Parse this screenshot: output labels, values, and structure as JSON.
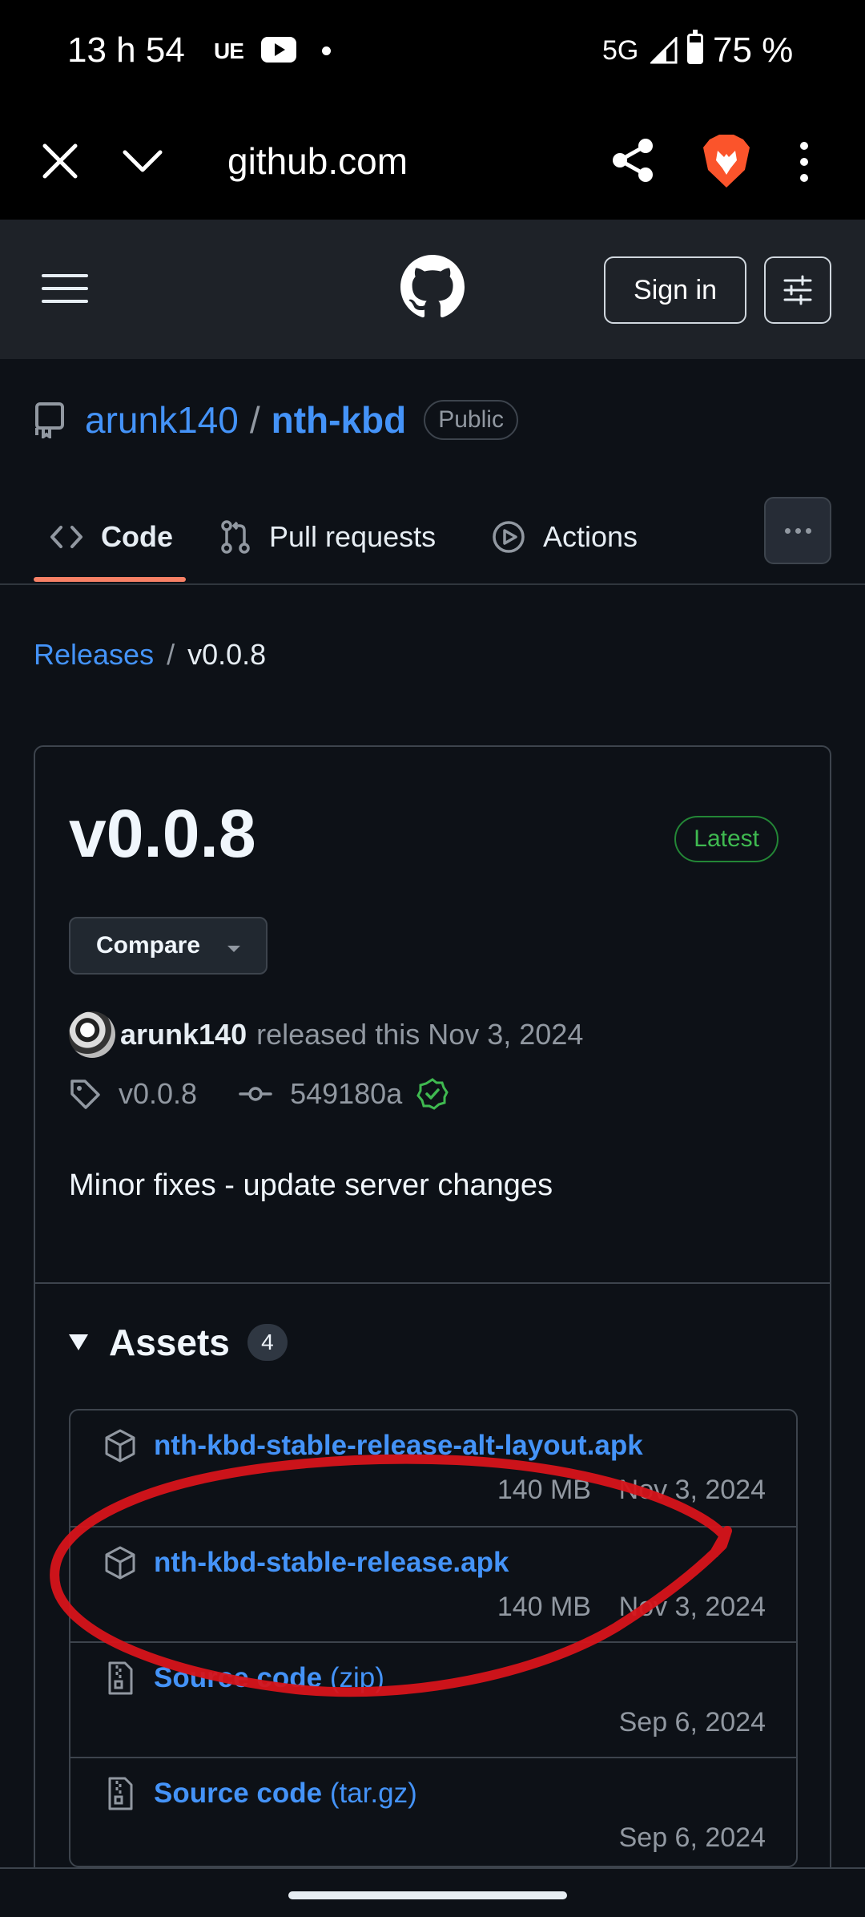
{
  "status": {
    "time": "13 h 54",
    "carrier": "UE",
    "network": "5G",
    "battery": "75 %"
  },
  "browser": {
    "url": "github.com"
  },
  "header": {
    "signin_label": "Sign in"
  },
  "repo": {
    "owner": "arunk140",
    "separator": "/",
    "name": "nth-kbd",
    "visibility": "Public"
  },
  "tabs": [
    {
      "label": "Code"
    },
    {
      "label": "Pull requests"
    },
    {
      "label": "Actions"
    }
  ],
  "breadcrumb": {
    "releases": "Releases",
    "separator": "/",
    "current": "v0.0.8"
  },
  "release": {
    "title": "v0.0.8",
    "badge": "Latest",
    "compare_label": "Compare",
    "author": "arunk140",
    "released_text": "released this Nov 3, 2024",
    "tag": "v0.0.8",
    "commit": "549180a",
    "notes": "Minor fixes - update server changes"
  },
  "assets": {
    "label": "Assets",
    "count": "4",
    "items": [
      {
        "name": "nth-kbd-stable-release-alt-layout.apk",
        "suffix": "",
        "size": "140 MB",
        "date": "Nov 3, 2024",
        "icon": "package-icon"
      },
      {
        "name": "nth-kbd-stable-release.apk",
        "suffix": "",
        "size": "140 MB",
        "date": "Nov 3, 2024",
        "icon": "package-icon"
      },
      {
        "name": "Source code",
        "suffix": "(zip)",
        "size": "",
        "date": "Sep 6, 2024",
        "icon": "file-zip-icon"
      },
      {
        "name": "Source code",
        "suffix": "(tar.gz)",
        "size": "",
        "date": "Sep 6, 2024",
        "icon": "file-zip-icon"
      }
    ]
  },
  "colors": {
    "link": "#4493f8",
    "latest": "#3fb950",
    "annotation": "#d7141a",
    "tab_underline": "#f78166"
  }
}
